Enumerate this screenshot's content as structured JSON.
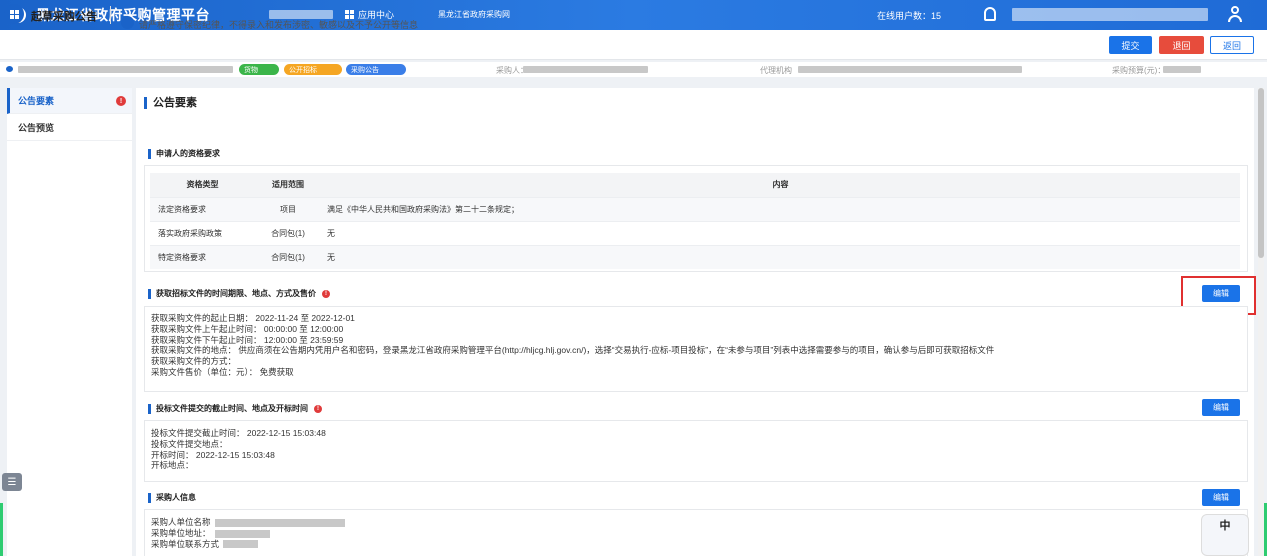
{
  "header": {
    "title": "黑龙江省政府采购管理平台",
    "app_center": "应用中心",
    "platform_link": "黑龙江省政府采购网",
    "online_users": "在线用户数：15"
  },
  "subheader": {
    "page_title": "起草采购公告",
    "notice": "请严格遵守保密纪律，不得录入和发布涉密、敏感以及不予公开等信息",
    "buttons": {
      "submit": "提交",
      "back": "退回",
      "return": "返回"
    }
  },
  "info": {
    "tags": [
      "货物",
      "公开招标",
      "采购公告"
    ],
    "purchaser_label": "采购人：",
    "agency_label": "代理机构",
    "budget_label": "采购预算(元)："
  },
  "sidebar": {
    "items": [
      {
        "label": "公告要素"
      },
      {
        "label": "公告预览"
      }
    ],
    "warn": "!"
  },
  "main": {
    "title": "公告要素",
    "qualification": {
      "title": "申请人的资格要求",
      "headers": [
        "资格类型",
        "适用范围",
        "内容"
      ],
      "rows": [
        {
          "type": "法定资格要求",
          "scope": "项目",
          "content": "满足《中华人民共和国政府采购法》第二十二条规定；"
        },
        {
          "type": "落实政府采购政策",
          "scope": "合同包(1)",
          "content": "无"
        },
        {
          "type": "特定资格要求",
          "scope": "合同包(1)",
          "content": "无"
        }
      ]
    },
    "obtain_doc": {
      "title": "获取招标文件的时间期限、地点、方式及售价",
      "edit": "编辑",
      "lines": [
        "获取采购文件的起止日期：   2022-11-24 至 2022-12-01",
        "获取采购文件上午起止时间：   00:00:00 至 12:00:00",
        "获取采购文件下午起止时间：   12:00:00 至 23:59:59",
        "获取采购文件的地点：   供应商须在公告期内凭用户名和密码，登录黑龙江省政府采购管理平台(http://hljcg.hlj.gov.cn/)，选择“交易执行-应标-项目投标”，在“未参与项目”列表中选择需要参与的项目，确认参与后即可获取招标文件",
        "获取采购文件的方式：",
        "采购文件售价（单位：元）：   免费获取"
      ]
    },
    "bid_submit": {
      "title": "投标文件提交的截止时间、地点及开标时间",
      "edit": "编辑",
      "lines": [
        "投标文件提交截止时间：   2022-12-15 15:03:48",
        "投标文件提交地点：",
        "开标时间：   2022-12-15 15:03:48",
        "开标地点："
      ]
    },
    "purchaser_info": {
      "title": "采购人信息",
      "edit": "编辑",
      "lines": [
        "采购人单位名称",
        "采购单位地址：",
        "采购单位联系方式"
      ]
    }
  },
  "assistant": {
    "label": "中"
  }
}
